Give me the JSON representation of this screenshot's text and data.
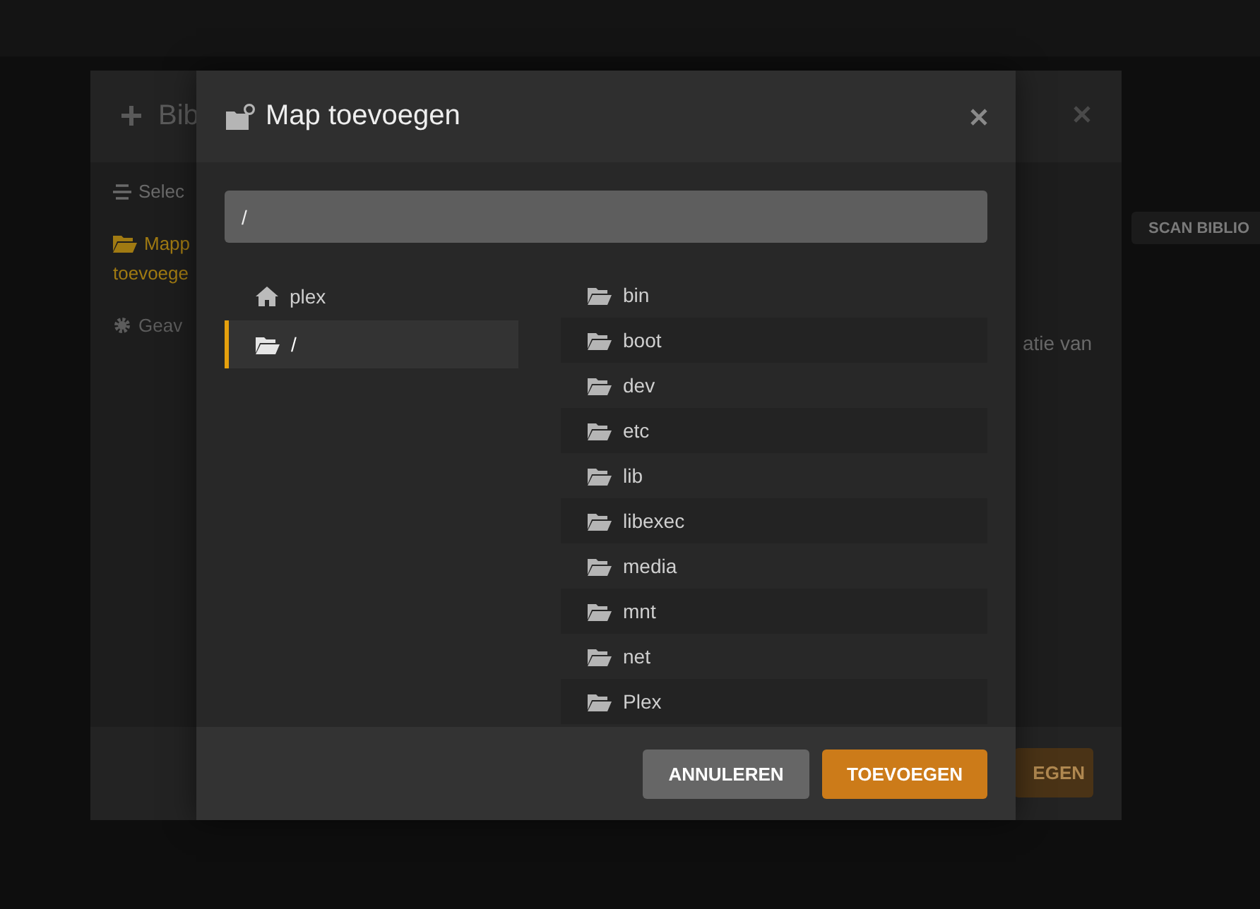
{
  "background_page": {
    "scan_button": "SCAN BIBLIO"
  },
  "background_dialog": {
    "title": "Bib",
    "nav": [
      {
        "lines": [
          "Selec"
        ],
        "selected": false,
        "disabled": false
      },
      {
        "lines": [
          "Mapp",
          "toevoege"
        ],
        "selected": true,
        "disabled": false
      },
      {
        "lines": [
          "Geav"
        ],
        "selected": false,
        "disabled": true
      }
    ],
    "description": "atie van",
    "confirm_button": "EGEN"
  },
  "modal": {
    "title": "Map toevoegen",
    "path_value": "/",
    "places": [
      {
        "label": "plex",
        "kind": "home",
        "selected": false
      },
      {
        "label": "/",
        "kind": "folder",
        "selected": true
      }
    ],
    "folders": [
      "bin",
      "boot",
      "dev",
      "etc",
      "lib",
      "libexec",
      "media",
      "mnt",
      "net",
      "Plex"
    ],
    "cancel_button": "ANNULEREN",
    "confirm_button": "TOEVOEGEN"
  }
}
